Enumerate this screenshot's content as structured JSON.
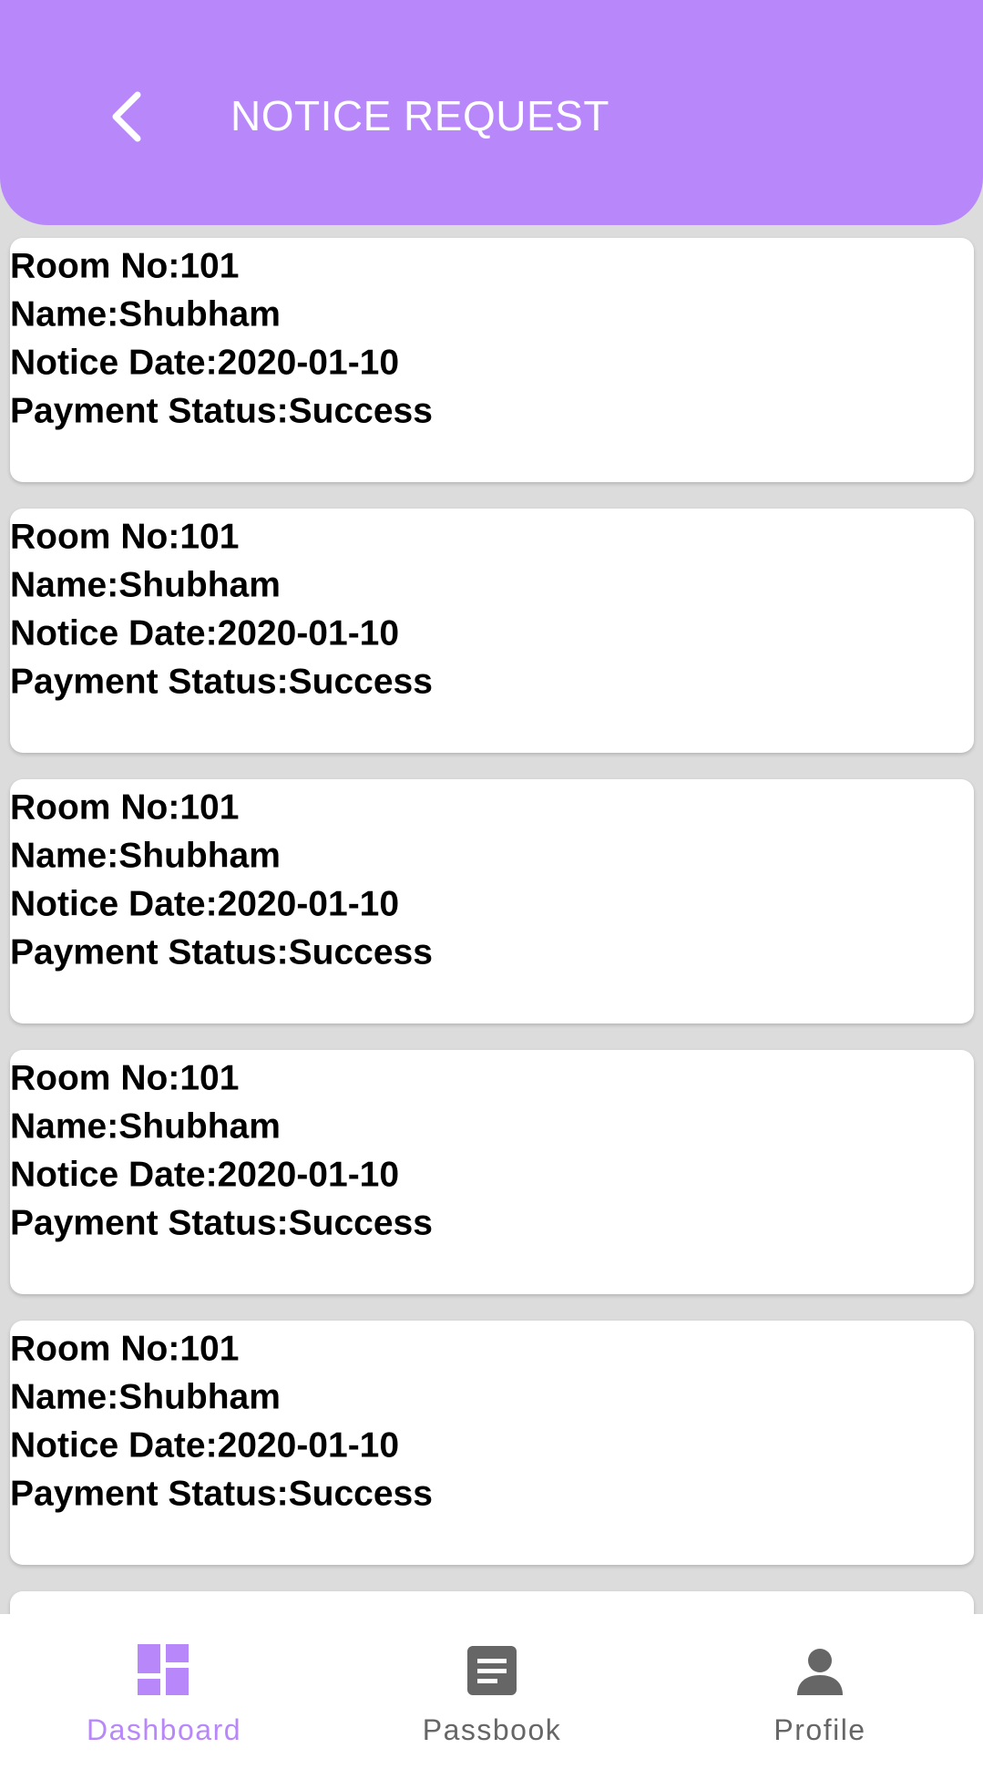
{
  "header": {
    "title": "NOTICE REQUEST",
    "background_color": "#b888fb",
    "back_icon": "chevron-left-icon"
  },
  "cards": [
    {
      "rows": [
        {
          "label": "Room No",
          "colon": ":",
          "value": "101"
        },
        {
          "label": "Name",
          "colon": ":",
          "value": "Shubham"
        },
        {
          "label": "Notice Date",
          "colon": ":",
          "value": "2020-01-10"
        },
        {
          "label": "Payment Status",
          "colon": ":",
          "value": "Success"
        }
      ]
    },
    {
      "rows": [
        {
          "label": "Room No",
          "colon": ":",
          "value": "101"
        },
        {
          "label": "Name",
          "colon": ":",
          "value": "Shubham"
        },
        {
          "label": "Notice Date",
          "colon": ":",
          "value": "2020-01-10"
        },
        {
          "label": "Payment Status",
          "colon": ":",
          "value": "Success"
        }
      ]
    },
    {
      "rows": [
        {
          "label": "Room No",
          "colon": ":",
          "value": "101"
        },
        {
          "label": "Name",
          "colon": ":",
          "value": "Shubham"
        },
        {
          "label": "Notice Date",
          "colon": ":",
          "value": "2020-01-10"
        },
        {
          "label": "Payment Status",
          "colon": ":",
          "value": "Success"
        }
      ]
    },
    {
      "rows": [
        {
          "label": "Room No",
          "colon": ":",
          "value": "101"
        },
        {
          "label": "Name",
          "colon": ":",
          "value": "Shubham"
        },
        {
          "label": "Notice Date",
          "colon": ":",
          "value": "2020-01-10"
        },
        {
          "label": "Payment Status",
          "colon": ":",
          "value": "Success"
        }
      ]
    },
    {
      "rows": [
        {
          "label": "Room No",
          "colon": ":",
          "value": "101"
        },
        {
          "label": "Name",
          "colon": ":",
          "value": "Shubham"
        },
        {
          "label": "Notice Date",
          "colon": ":",
          "value": "2020-01-10"
        },
        {
          "label": "Payment Status",
          "colon": ":",
          "value": "Success"
        }
      ]
    }
  ],
  "bottom_nav": {
    "active": "dashboard",
    "active_color": "#b888fb",
    "inactive_color": "#666666",
    "items": [
      {
        "id": "dashboard",
        "label": "Dashboard",
        "icon": "dashboard-icon"
      },
      {
        "id": "passbook",
        "label": "Passbook",
        "icon": "passbook-icon"
      },
      {
        "id": "profile",
        "label": "Profile",
        "icon": "profile-icon"
      }
    ]
  }
}
